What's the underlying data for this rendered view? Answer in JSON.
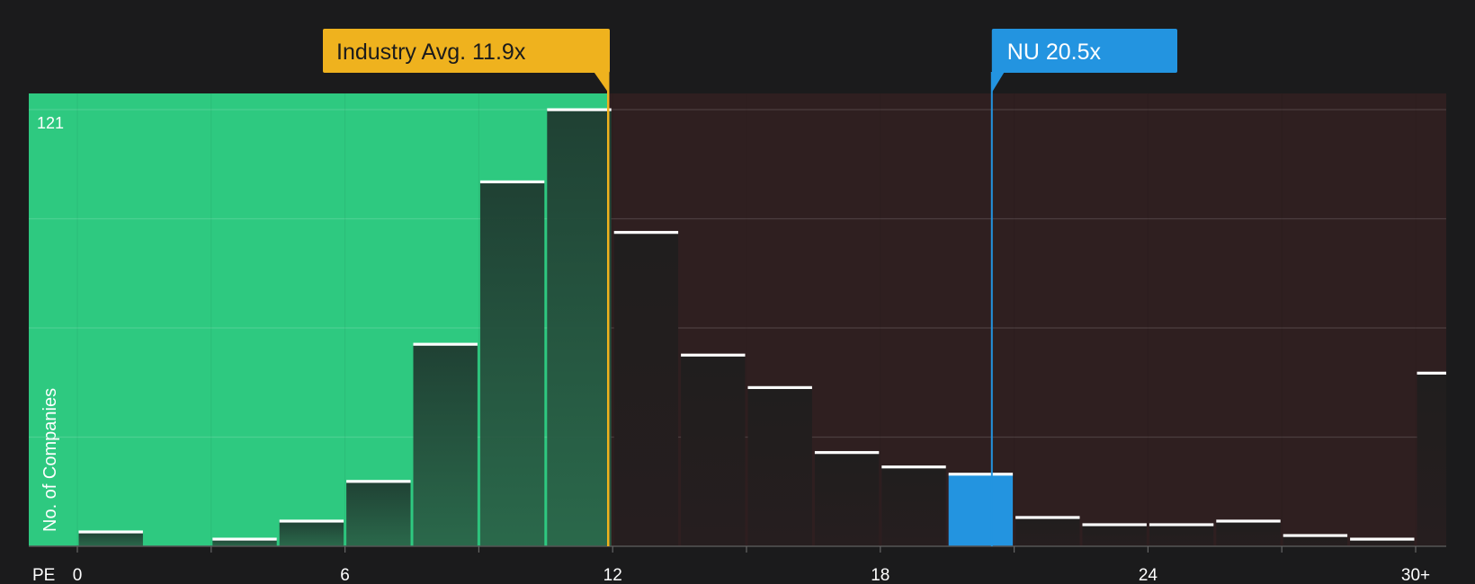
{
  "chart_data": {
    "type": "bar",
    "x_axis_label": "PE",
    "y_axis_label": "No. of Companies",
    "y_max_label": "121",
    "ylim": [
      0,
      121
    ],
    "x_ticks": [
      {
        "value": 0,
        "label": "0"
      },
      {
        "value": 6,
        "label": "6"
      },
      {
        "value": 12,
        "label": "12"
      },
      {
        "value": 18,
        "label": "18"
      },
      {
        "value": 24,
        "label": "24"
      },
      {
        "value": 30,
        "label": "30+"
      }
    ],
    "bin_width": 1.5,
    "bins": [
      {
        "start": 0.0,
        "value": 4
      },
      {
        "start": 1.5,
        "value": 0
      },
      {
        "start": 3.0,
        "value": 2
      },
      {
        "start": 4.5,
        "value": 7
      },
      {
        "start": 6.0,
        "value": 18
      },
      {
        "start": 7.5,
        "value": 56
      },
      {
        "start": 9.0,
        "value": 101
      },
      {
        "start": 10.5,
        "value": 121
      },
      {
        "start": 12.0,
        "value": 87
      },
      {
        "start": 13.5,
        "value": 53
      },
      {
        "start": 15.0,
        "value": 44
      },
      {
        "start": 16.5,
        "value": 26
      },
      {
        "start": 18.0,
        "value": 22
      },
      {
        "start": 19.5,
        "value": 20,
        "highlight": true
      },
      {
        "start": 21.0,
        "value": 8
      },
      {
        "start": 22.5,
        "value": 6
      },
      {
        "start": 24.0,
        "value": 6
      },
      {
        "start": 25.5,
        "value": 7
      },
      {
        "start": 27.0,
        "value": 3
      },
      {
        "start": 28.5,
        "value": 2
      },
      {
        "start": 30.0,
        "value": 48,
        "overflow": true
      }
    ],
    "industry_avg": {
      "value": 11.9,
      "label": "Industry Avg. 11.9x"
    },
    "company": {
      "name": "NU",
      "value": 20.5,
      "label": "NU 20.5x"
    },
    "colors": {
      "background": "#1b1b1c",
      "undervalued_region": "#2ec980",
      "overvalued_region": "#2f1f20",
      "industry_avg": "#efb21e",
      "company": "#2394e0",
      "bar_top": "#ffffff"
    }
  }
}
